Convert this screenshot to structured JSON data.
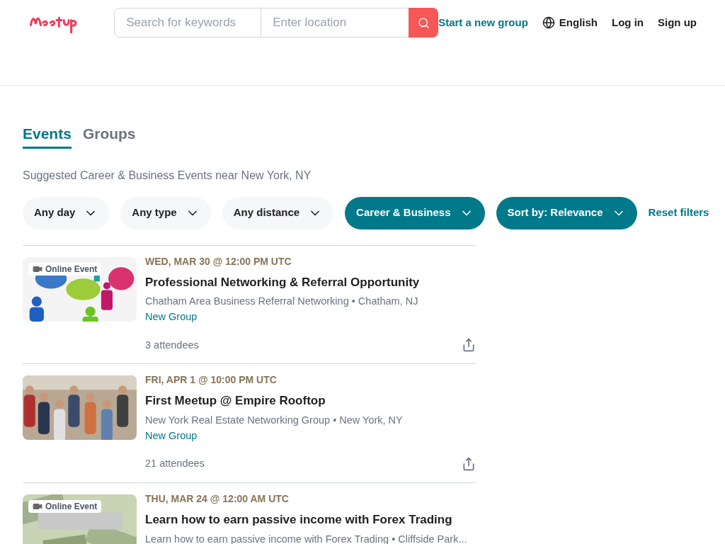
{
  "header": {
    "search_placeholder": "Search for keywords",
    "location_placeholder": "Enter location",
    "nav": [
      {
        "kind": "link",
        "label": "Start a new group"
      },
      {
        "kind": "language",
        "label": "English"
      },
      {
        "kind": "plain",
        "label": "Log in"
      },
      {
        "kind": "plain",
        "label": "Sign up"
      }
    ]
  },
  "tabs": [
    {
      "label": "Events",
      "selected": true
    },
    {
      "label": "Groups",
      "selected": false
    }
  ],
  "heading": "Suggested Career & Business Events near New York, NY",
  "filters": [
    {
      "label": "Any day",
      "active": false
    },
    {
      "label": "Any type",
      "active": false
    },
    {
      "label": "Any distance",
      "active": false
    },
    {
      "label": "Career & Business",
      "active": true
    },
    {
      "label": "Sort by: Relevance",
      "active": true
    }
  ],
  "reset_label": "Reset filters",
  "events": [
    {
      "online": "Online Event",
      "date": "WED, MAR 30 @ 12:00 PM UTC",
      "title": "Professional Networking & Referral Opportunity",
      "group": "Chatham Area Business Referral Networking • Chatham, NJ",
      "badge": "New Group",
      "attendees": "3 attendees"
    },
    {
      "date": "FRI, APR 1 @ 10:00 PM UTC",
      "title": "First Meetup @ Empire Rooftop",
      "group": "New York Real Estate Networking Group • New York, NY",
      "badge": "New Group",
      "attendees": "21 attendees"
    },
    {
      "online": "Online Event",
      "date": "THU, MAR 24 @ 12:00 AM UTC",
      "title": "Learn how to earn passive income with Forex Trading",
      "group": "Learn how to earn passive income with Forex Trading • Cliffside Park..."
    }
  ]
}
